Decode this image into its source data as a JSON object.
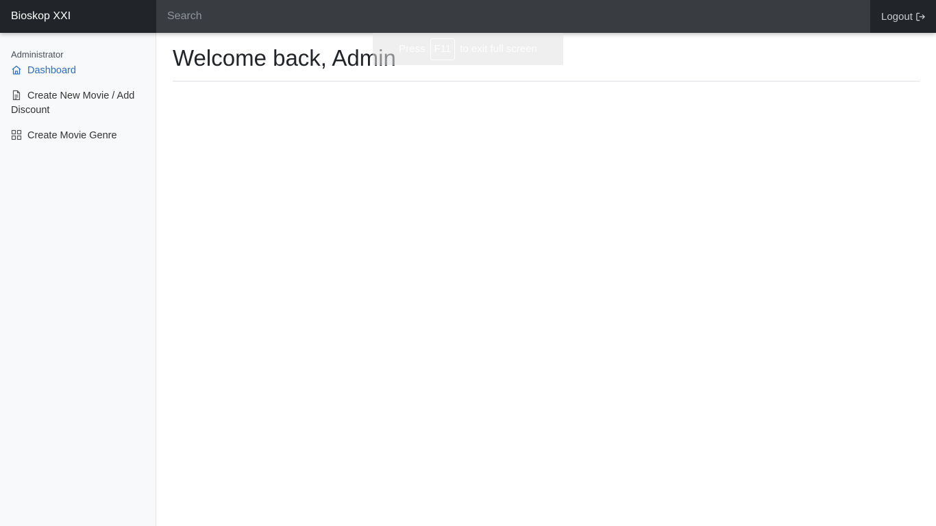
{
  "header": {
    "brand": "Bioskop XXI",
    "search_placeholder": "Search",
    "logout_label": "Logout"
  },
  "sidebar": {
    "heading": "Administrator",
    "items": [
      {
        "label": "Dashboard",
        "icon": "home-icon",
        "active": true
      },
      {
        "label": "Create New Movie / Add Discount",
        "icon": "file-icon",
        "active": false
      },
      {
        "label": "Create Movie Genre",
        "icon": "grid-icon",
        "active": false
      }
    ]
  },
  "main": {
    "title": "Welcome back, Admin"
  },
  "fullscreen_hint": {
    "prefix": "Press",
    "key": "F11",
    "suffix": "to exit full screen"
  },
  "colors": {
    "topbar": "#343a40",
    "brand_bg": "#212529",
    "sidebar_bg": "#f8f9fa",
    "active_link": "#2f6fc5"
  }
}
